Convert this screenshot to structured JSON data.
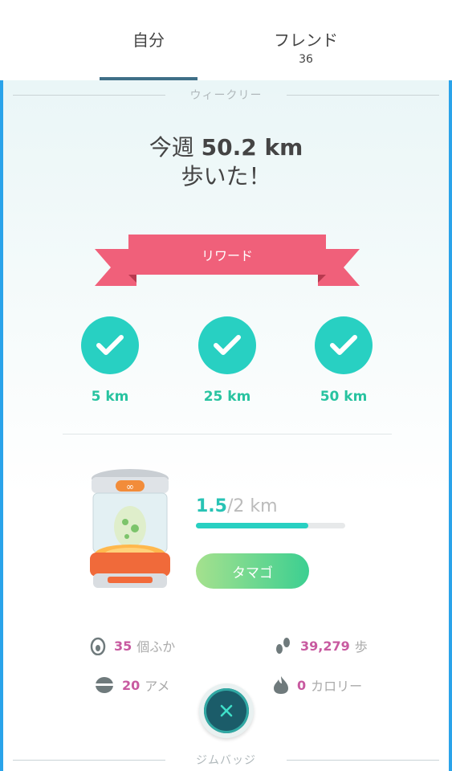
{
  "tabs": {
    "self_label": "自分",
    "friends_label": "フレンド",
    "friends_count": "36"
  },
  "weekly": {
    "section_title": "ウィークリー",
    "headline_prefix": "今週",
    "distance": "50.2 km",
    "headline_suffix": "歩いた！",
    "ribbon_label": "リワード",
    "rewards": [
      {
        "km": "5 km"
      },
      {
        "km": "25 km"
      },
      {
        "km": "50 km"
      }
    ]
  },
  "egg": {
    "current": "1.5",
    "total": "/2 km",
    "progress": 0.75,
    "button_label": "タマゴ"
  },
  "stats": {
    "hatched_num": "35",
    "hatched_label": "個ふか",
    "steps_num": "39,279",
    "steps_label": "歩",
    "candy_num": "20",
    "candy_label": "アメ",
    "calories_num": "0",
    "calories_label": "カロリー"
  },
  "gym": {
    "section_title": "ジムバッジ"
  },
  "colors": {
    "accent_teal": "#28d0c2",
    "ribbon_pink": "#f0607a",
    "stat_pink": "#c85aa0",
    "frame_blue": "#2aa3ea"
  }
}
